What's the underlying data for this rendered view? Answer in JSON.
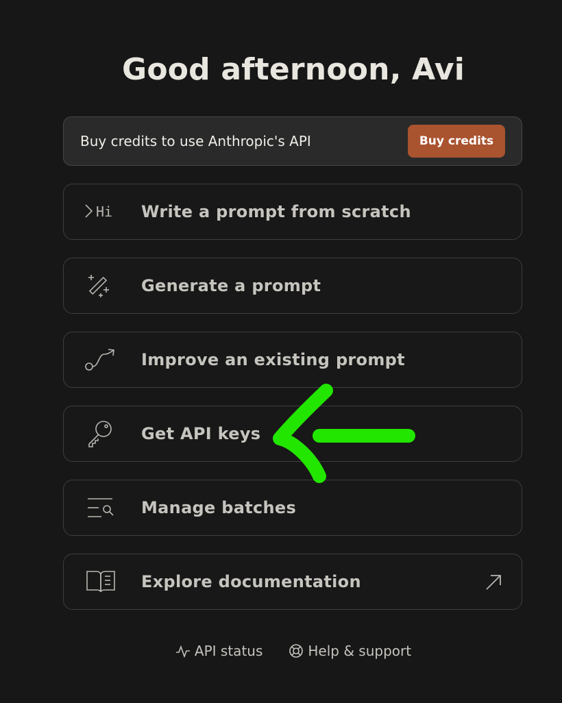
{
  "greeting": "Good afternoon, Avi",
  "credits_banner": {
    "text": "Buy credits to use Anthropic's API",
    "button_label": "Buy credits",
    "button_color": "#a9532f"
  },
  "actions": [
    {
      "label": "Write a prompt from scratch",
      "icon": "prompt-terminal-icon",
      "icon_text": "Hi"
    },
    {
      "label": "Generate a prompt",
      "icon": "magic-wand-icon"
    },
    {
      "label": "Improve an existing prompt",
      "icon": "path-arrow-icon"
    },
    {
      "label": "Get API keys",
      "icon": "key-icon"
    },
    {
      "label": "Manage batches",
      "icon": "list-search-icon"
    },
    {
      "label": "Explore documentation",
      "icon": "book-icon",
      "trailing_icon": "external-link-icon"
    }
  ],
  "footer": {
    "api_status": "API status",
    "help_support": "Help & support"
  },
  "annotation": {
    "type": "hand-drawn-arrow",
    "color": "#22e600",
    "points_to": "Get API keys"
  }
}
